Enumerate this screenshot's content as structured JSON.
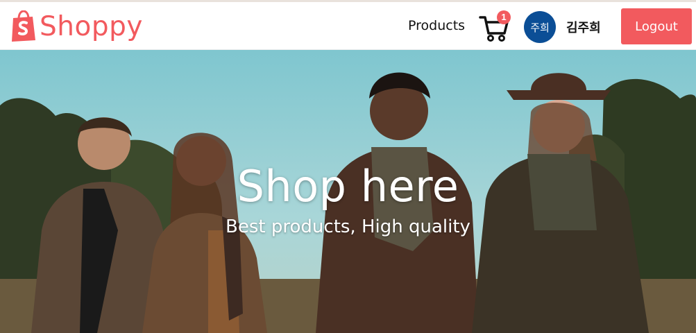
{
  "brand": {
    "name": "Shoppy",
    "color": "#f25a5e",
    "icon": "shopping-bag-icon"
  },
  "nav": {
    "products_label": "Products"
  },
  "cart": {
    "count": "1",
    "icon": "cart-icon"
  },
  "user": {
    "avatar_text": "주희",
    "name": "김주희",
    "avatar_color": "#0b4e96"
  },
  "actions": {
    "logout_label": "Logout"
  },
  "hero": {
    "title": "Shop here",
    "subtitle": "Best products, High quality"
  }
}
